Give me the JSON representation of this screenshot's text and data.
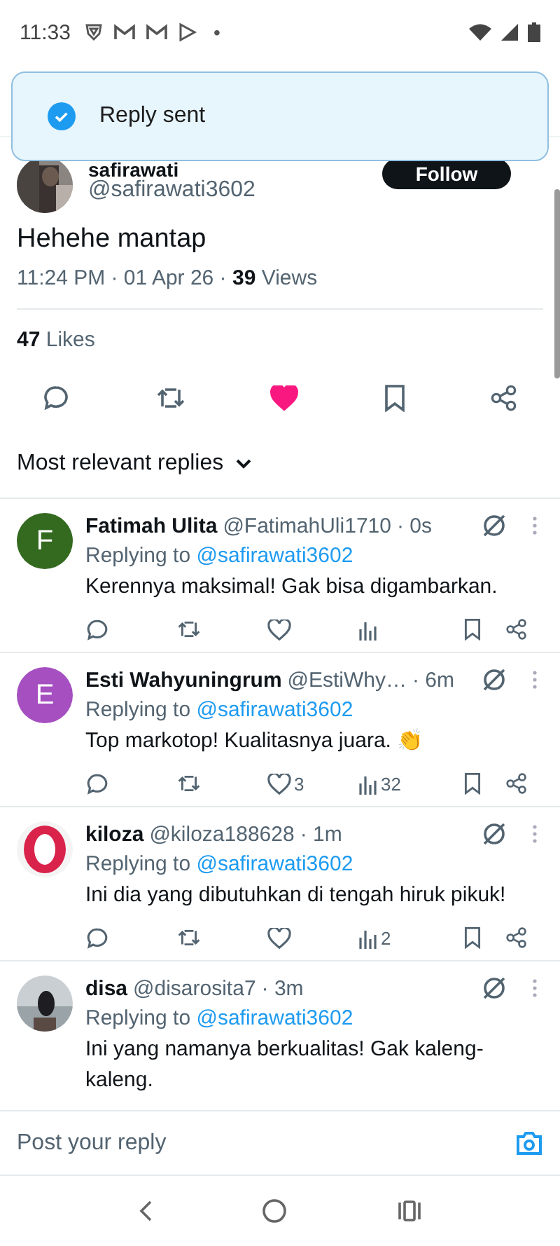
{
  "status_bar": {
    "time": "11:33",
    "dot": "•"
  },
  "toast": {
    "message": "Reply sent"
  },
  "post": {
    "name": "safirawati",
    "handle": "@safirawati3602",
    "follow": "Follow",
    "text": "Hehehe mantap",
    "time": "11:24 PM · 01 Apr 26 · ",
    "views_count": "39",
    "views_label": " Views",
    "likes_count": "47",
    "likes_label": " Likes",
    "actions": [
      {
        "kind": "reply"
      },
      {
        "kind": "repost"
      },
      {
        "kind": "like",
        "on": true
      },
      {
        "kind": "bookmark"
      },
      {
        "kind": "share"
      }
    ]
  },
  "sort": {
    "label": "Most relevant replies"
  },
  "replies": [
    {
      "name": "Fatimah Ulita",
      "handle": "@FatimahUli1710",
      "time": "· 0s",
      "avatar": {
        "kind": "letter",
        "letter": "F",
        "color": "#336a1f"
      },
      "replying_prefix": "Replying to ",
      "replying_handle": "@safirawati3602",
      "text": "Kerennya maksimal! Gak bisa digambarkan.",
      "actions": [
        {
          "kind": "reply"
        },
        {
          "kind": "repost"
        },
        {
          "kind": "like",
          "on": false
        },
        {
          "kind": "views"
        },
        {
          "kind": "bookmark"
        },
        {
          "kind": "share"
        }
      ]
    },
    {
      "name": "Esti Wahyuningrum",
      "handle": "@EstiWhy…",
      "time": "· 6m",
      "avatar": {
        "kind": "letter",
        "letter": "E",
        "color": "#a54fc0"
      },
      "replying_prefix": "Replying to ",
      "replying_handle": "@safirawati3602",
      "text": "Top markotop! Kualitasnya juara. 👏",
      "actions": [
        {
          "kind": "reply"
        },
        {
          "kind": "repost"
        },
        {
          "kind": "like",
          "on": false,
          "count": "3"
        },
        {
          "kind": "views",
          "count": "32"
        },
        {
          "kind": "bookmark"
        },
        {
          "kind": "share"
        }
      ]
    },
    {
      "name": "kiloza",
      "handle": "@kiloza188628",
      "time": "· 1m",
      "avatar": {
        "kind": "ring"
      },
      "replying_prefix": "Replying to ",
      "replying_handle": "@safirawati3602",
      "text": "Ini dia yang dibutuhkan di tengah hiruk pikuk!",
      "actions": [
        {
          "kind": "reply"
        },
        {
          "kind": "repost"
        },
        {
          "kind": "like",
          "on": false
        },
        {
          "kind": "views",
          "count": "2"
        },
        {
          "kind": "bookmark"
        },
        {
          "kind": "share"
        }
      ]
    },
    {
      "name": "disa",
      "handle": "@disarosita7",
      "time": "· 3m",
      "replying_prefix": "Replying to ",
      "replying_handle": "@safirawati3602",
      "text": "Ini yang namanya berkualitas! Gak kaleng-kaleng."
    }
  ],
  "composer": {
    "placeholder": "Post your reply"
  }
}
